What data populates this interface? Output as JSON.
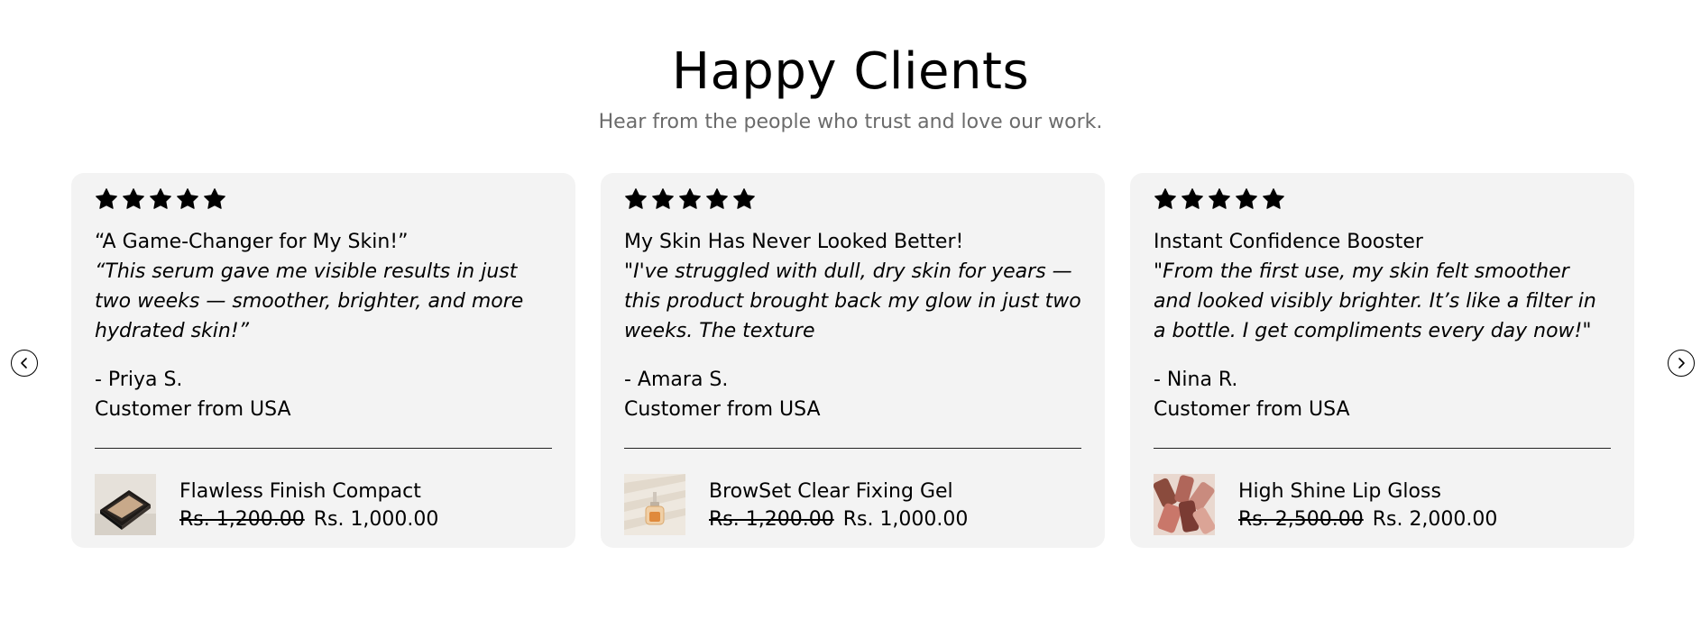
{
  "section": {
    "heading": "Happy Clients",
    "subheading": "Hear from the people who trust and love our work."
  },
  "colors": {
    "card_background": "#f3f3f3",
    "subheading_text": "#6b6b6b",
    "star": "#000000"
  },
  "navigation": {
    "prev_icon": "chevron-left-icon",
    "next_icon": "chevron-right-icon"
  },
  "testimonials": [
    {
      "rating": 5,
      "title": "“A Game-Changer for My Skin!”",
      "quote": "“This serum gave me visible results in just two weeks — smoother, brighter, and more hydrated skin!”",
      "author": "- Priya S.",
      "location": "Customer from USA",
      "product": {
        "name": "Flawless Finish Compact",
        "old_price": "Rs. 1,200.00",
        "price": "Rs. 1,000.00",
        "icon": "compact-product-thumbnail"
      }
    },
    {
      "rating": 5,
      "title": "My Skin Has Never Looked Better!",
      "quote": "\"I've struggled with dull, dry skin for years — this product brought back my glow in just two weeks. The texture",
      "author": "- Amara S.",
      "location": "Customer from USA",
      "product": {
        "name": "BrowSet Clear Fixing Gel",
        "old_price": "Rs. 1,200.00",
        "price": "Rs. 1,000.00",
        "icon": "gel-bottle-product-thumbnail"
      }
    },
    {
      "rating": 5,
      "title": "Instant Confidence Booster",
      "quote": "\"From the first use, my skin felt smoother and looked visibly brighter. It’s like a filter in a bottle. I get compliments every day now!\"",
      "author": "- Nina R.",
      "location": "Customer from USA",
      "product": {
        "name": "High Shine Lip Gloss",
        "old_price": "Rs. 2,500.00",
        "price": "Rs. 2,000.00",
        "icon": "lip-gloss-product-thumbnail"
      }
    }
  ]
}
